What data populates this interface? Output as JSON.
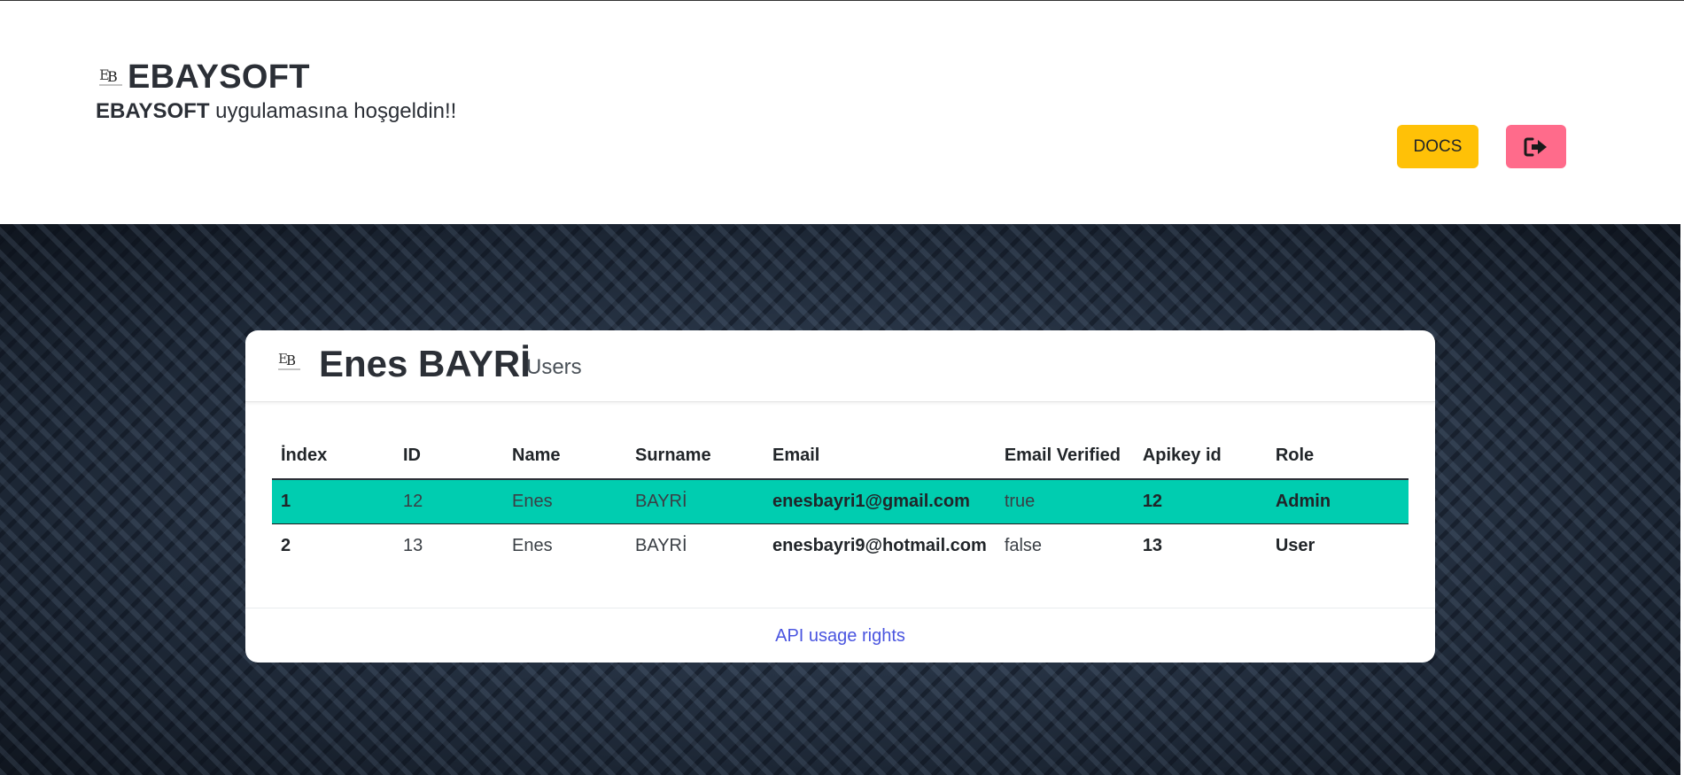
{
  "header": {
    "brand_title": "EBAYSOFT",
    "welcome_brand": "EBAYSOFT",
    "welcome_text": " uygulamasına hoşgeldin!!",
    "docs_label": "DOCS",
    "logout_icon": "sign-out-icon"
  },
  "card": {
    "title": "Enes BAYRİ",
    "subtitle": "Users",
    "table": {
      "columns": [
        "İndex",
        "ID",
        "Name",
        "Surname",
        "Email",
        "Email Verified",
        "Apikey id",
        "Role"
      ],
      "rows": [
        [
          "1",
          "12",
          "Enes",
          "BAYRİ",
          "enesbayri1@gmail.com",
          "true",
          "12",
          "Admin"
        ],
        [
          "2",
          "13",
          "Enes",
          "BAYRİ",
          "enesbayri9@hotmail.com",
          "false",
          "13",
          "User"
        ]
      ]
    },
    "footer_link": "API usage rights"
  },
  "colors": {
    "docs_button": "#ffc107",
    "logout_button": "#ff6b8b",
    "active_row": "#00cdb0",
    "link": "#4a55e0"
  }
}
